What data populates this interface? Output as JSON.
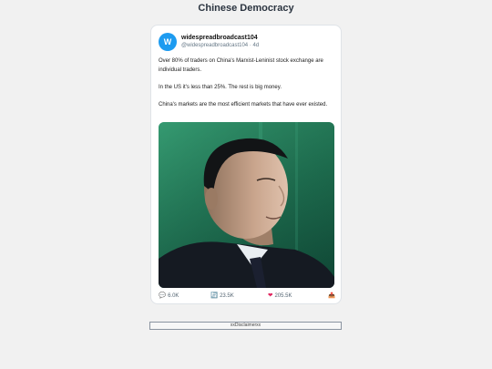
{
  "page": {
    "title": "Chinese Democracy"
  },
  "tweet": {
    "avatar_letter": "W",
    "display_name": "widespreadbroadcast104",
    "handle": "@widespreadbroadcast104",
    "separator": "·",
    "age": "4d",
    "paragraphs": [
      "Over 80% of traders on China's Marxist-Leninist stock exchange are individual traders.",
      "In the US it's less than 25%. The rest is big money.",
      "China's markets are the most efficient markets that have ever existed."
    ],
    "actions": {
      "replies": "6.0K",
      "retweets": "23.5K",
      "likes": "205.5K"
    }
  },
  "footer": {
    "label": "xxDisclaimerxx"
  },
  "icons": {
    "reply": "speech-bubble-icon",
    "retweet": "retweet-icon",
    "like": "heart-icon",
    "share": "share-icon"
  },
  "colors": {
    "avatar": "#1d9bf0",
    "like": "#e0245e"
  }
}
